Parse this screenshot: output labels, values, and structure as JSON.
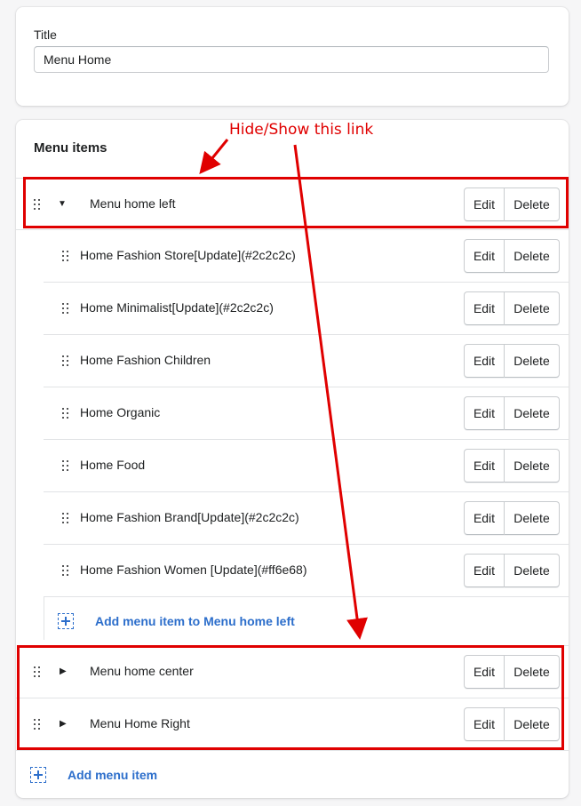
{
  "title_card": {
    "label": "Title",
    "value": "Menu Home"
  },
  "menu_card": {
    "heading": "Menu items",
    "buttons": {
      "edit": "Edit",
      "delete": "Delete"
    },
    "items": [
      {
        "label": "Menu home left",
        "expanded": true
      },
      {
        "label": "Menu home center",
        "expanded": false
      },
      {
        "label": "Menu Home Right",
        "expanded": false
      }
    ],
    "children": [
      "Home Fashion Store[Update](#2c2c2c)",
      "Home Minimalist[Update](#2c2c2c)",
      "Home Fashion Children",
      "Home Organic",
      "Home Food",
      "Home Fashion Brand[Update](#2c2c2c)",
      "Home Fashion Women [Update](#ff6e68)"
    ],
    "add_child_label": "Add menu item to Menu home left",
    "add_item_label": "Add menu item"
  },
  "annotation": {
    "text": "Hide/Show this link",
    "color": "#e00000"
  },
  "colors": {
    "link": "#2c6ecb",
    "border": "#c9cccf"
  }
}
